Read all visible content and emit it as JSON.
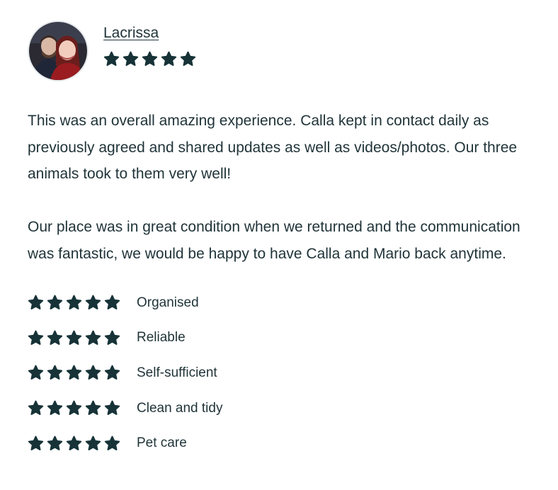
{
  "review": {
    "reviewer_name": "Lacrissa",
    "overall_rating": 5,
    "paragraphs": [
      "This was an overall amazing experience. Calla kept in contact daily as previously agreed and shared updates as well as videos/photos. Our three animals took to them very well!",
      "Our place was in great condition when we returned and the communication was fantastic, we would be happy to have Calla and Mario back anytime."
    ],
    "ratings": [
      {
        "label": "Organised",
        "stars": 5
      },
      {
        "label": "Reliable",
        "stars": 5
      },
      {
        "label": "Self-sufficient",
        "stars": 5
      },
      {
        "label": "Clean and tidy",
        "stars": 5
      },
      {
        "label": "Pet care",
        "stars": 5
      }
    ]
  },
  "colors": {
    "text": "#1f3338",
    "star": "#173338",
    "avatar_border": "#e7ebec"
  },
  "icons": {
    "star": "star-icon",
    "avatar": "reviewer-avatar-photo"
  }
}
